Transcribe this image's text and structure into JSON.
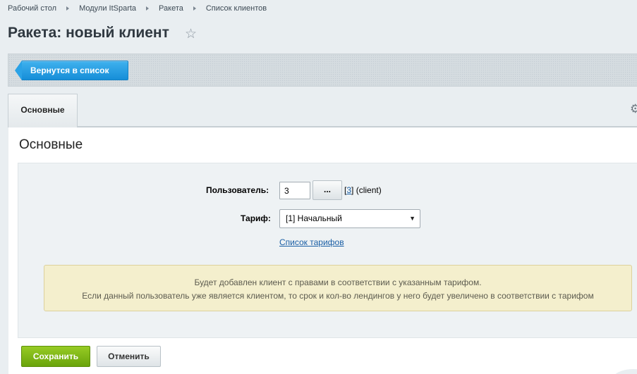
{
  "breadcrumbs": [
    "Рабочий стол",
    "Модули ItSparta",
    "Ракета",
    "Список клиентов"
  ],
  "page_title": "Ракета: новый клиент",
  "toolbar": {
    "back_label": "Вернутся в список"
  },
  "tabs": [
    {
      "label": "Основные",
      "active": true
    }
  ],
  "section_title": "Основные",
  "form": {
    "user_label": "Пользователь:",
    "user_value": "3",
    "browse_label": "...",
    "user_info_open": "[",
    "user_info_id": "3",
    "user_info_rest": "] (client)",
    "tariff_label": "Тариф:",
    "tariff_selected": "[1] Начальный",
    "tariff_list_link": "Список тарифов"
  },
  "notice": {
    "line1": "Будет добавлен клиент с правами в соответствии с указанным тарифом.",
    "line2": "Если данный пользователь уже является клиентом, то срок и кол-во лендингов у него будет увеличено в соответствии с тарифом"
  },
  "actions": {
    "save_label": "Сохранить",
    "cancel_label": "Отменить"
  },
  "icons": {
    "favorite": "star-icon",
    "settings": "gear-icon",
    "dropdown": "chevron-down-icon"
  },
  "colors": {
    "back_button": "#1e9ae0",
    "save_button": "#7fb816",
    "link": "#1a5fa5",
    "notice_bg": "#f4efcd"
  }
}
